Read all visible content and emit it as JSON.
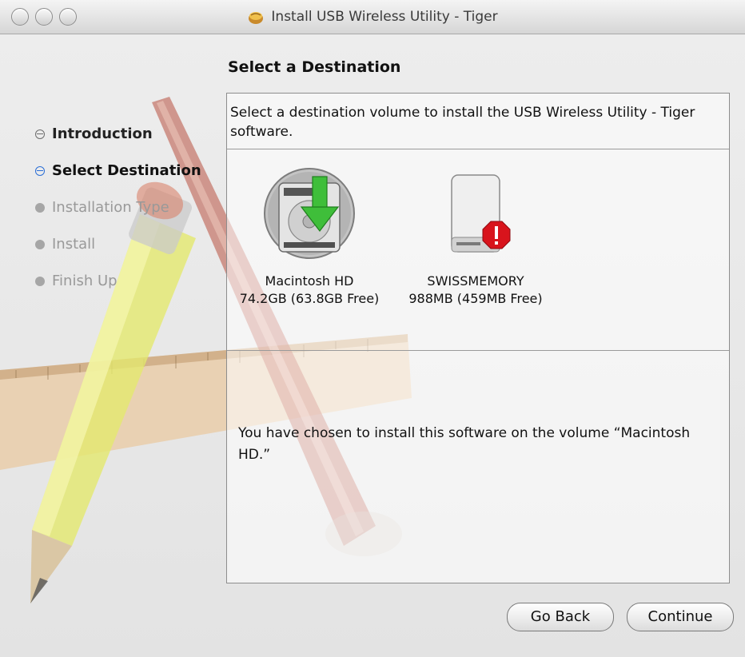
{
  "window": {
    "title": "Install USB Wireless Utility - Tiger"
  },
  "heading": "Select a Destination",
  "steps": [
    {
      "label": "Introduction",
      "state": "done"
    },
    {
      "label": "Select Destination",
      "state": "current"
    },
    {
      "label": "Installation Type",
      "state": "pending"
    },
    {
      "label": "Install",
      "state": "pending"
    },
    {
      "label": "Finish Up",
      "state": "pending"
    }
  ],
  "panel": {
    "description": "Select a destination volume to install the USB Wireless Utility - Tiger software.",
    "volumes": [
      {
        "name": "Macintosh HD",
        "size": "74.2GB (63.8GB Free)",
        "selected": true,
        "icon": "hard-drive-install-icon"
      },
      {
        "name": "SWISSMEMORY",
        "size": "988MB (459MB Free)",
        "selected": false,
        "icon": "removable-drive-warning-icon"
      }
    ],
    "message": "You have chosen to install this software on the volume “Macintosh HD.”"
  },
  "buttons": {
    "back": "Go Back",
    "continue": "Continue"
  },
  "colors": {
    "current_step": "#2c6fd6",
    "warning": "#d8141c",
    "install_arrow": "#3fbe3a"
  }
}
